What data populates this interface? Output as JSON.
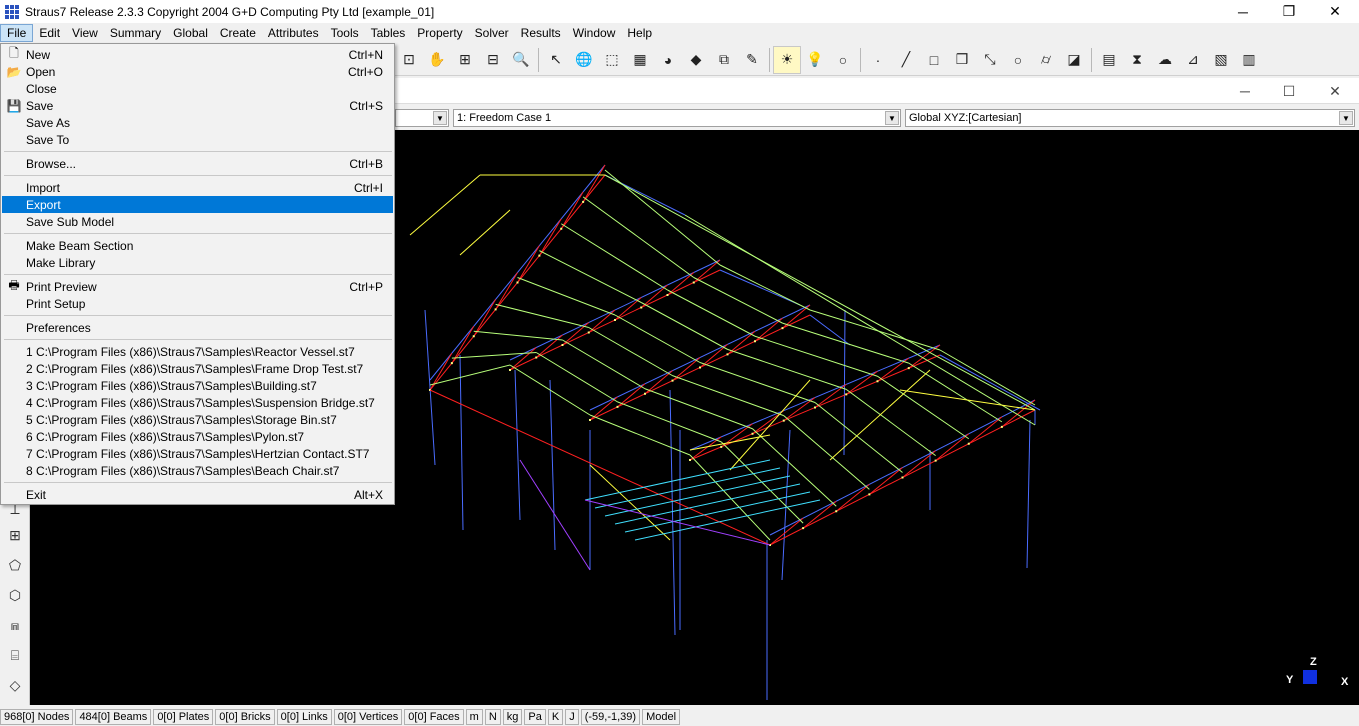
{
  "window": {
    "title": "Straus7 Release 2.3.3 Copyright 2004 G+D Computing Pty Ltd [example_01]"
  },
  "menubar": {
    "items": [
      "File",
      "Edit",
      "View",
      "Summary",
      "Global",
      "Create",
      "Attributes",
      "Tools",
      "Tables",
      "Property",
      "Solver",
      "Results",
      "Window",
      "Help"
    ]
  },
  "file_menu": {
    "new": {
      "label": "New",
      "shortcut": "Ctrl+N"
    },
    "open": {
      "label": "Open",
      "shortcut": "Ctrl+O"
    },
    "close": {
      "label": "Close"
    },
    "save": {
      "label": "Save",
      "shortcut": "Ctrl+S"
    },
    "save_as": {
      "label": "Save As"
    },
    "save_to": {
      "label": "Save To"
    },
    "browse": {
      "label": "Browse...",
      "shortcut": "Ctrl+B"
    },
    "import": {
      "label": "Import",
      "shortcut": "Ctrl+I"
    },
    "export": {
      "label": "Export"
    },
    "save_sub_model": {
      "label": "Save Sub Model"
    },
    "make_beam_section": {
      "label": "Make Beam Section"
    },
    "make_library": {
      "label": "Make Library"
    },
    "print_preview": {
      "label": "Print Preview",
      "shortcut": "Ctrl+P"
    },
    "print_setup": {
      "label": "Print Setup"
    },
    "preferences": {
      "label": "Preferences"
    },
    "recent": [
      "1 C:\\Program Files (x86)\\Straus7\\Samples\\Reactor Vessel.st7",
      "2 C:\\Program Files (x86)\\Straus7\\Samples\\Frame Drop Test.st7",
      "3 C:\\Program Files (x86)\\Straus7\\Samples\\Building.st7",
      "4 C:\\Program Files (x86)\\Straus7\\Samples\\Suspension Bridge.st7",
      "5 C:\\Program Files (x86)\\Straus7\\Samples\\Storage Bin.st7",
      "6 C:\\Program Files (x86)\\Straus7\\Samples\\Pylon.st7",
      "7 C:\\Program Files (x86)\\Straus7\\Samples\\Hertzian Contact.ST7",
      "8 C:\\Program Files (x86)\\Straus7\\Samples\\Beach Chair.st7"
    ],
    "exit": {
      "label": "Exit",
      "shortcut": "Alt+X"
    }
  },
  "combos": {
    "freedom_case": "1: Freedom Case 1",
    "ucs": "Global XYZ:[Cartesian]"
  },
  "triad": {
    "x": "X",
    "y": "Y",
    "z": "Z"
  },
  "status": {
    "cells": [
      "968[0] Nodes",
      "484[0] Beams",
      "0[0] Plates",
      "0[0] Bricks",
      "0[0] Links",
      "0[0] Vertices",
      "0[0] Faces",
      "m",
      "N",
      "kg",
      "Pa",
      "K",
      "J",
      "(-59,-1,39)",
      "Model"
    ]
  },
  "colors": {
    "viewport_bg": "#000000",
    "column_blue": "#4a6cff",
    "rafter_red": "#ff2020",
    "purlin_green": "#b8ff7a",
    "brace_yellow": "#ffff40",
    "node_yellow": "#ffff80",
    "menu_highlight": "#0078d7"
  }
}
